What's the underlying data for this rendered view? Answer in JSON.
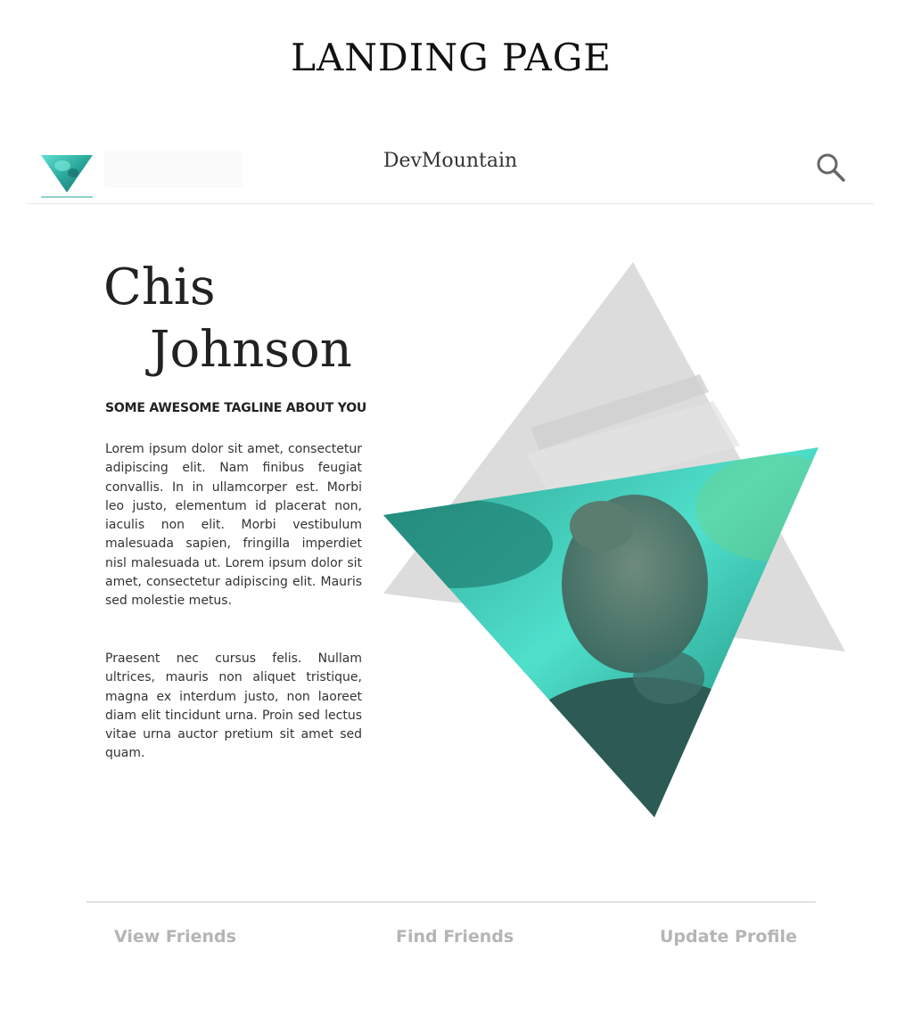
{
  "page": {
    "title": "LANDING PAGE"
  },
  "header": {
    "brand": "DevMountain",
    "search_input_value": "",
    "logo_icon": "triangle-logo-icon",
    "search_icon": "search-icon"
  },
  "hero": {
    "first_name": "Chis",
    "last_name": "Johnson",
    "tagline": "SOME AWESOME TAGLINE ABOUT YOU",
    "paragraphs": [
      "Lorem ipsum dolor sit amet, consectetur adipiscing elit. Nam finibus feugiat convallis. In in ullamcorper est. Morbi leo justo, elementum id placerat non, iaculis non elit. Morbi vestibulum malesuada sapien, fringilla imperdiet nisl malesuada ut. Lorem ipsum dolor sit amet, consectetur adipiscing elit. Mauris sed molestie metus.",
      "Praesent nec cursus felis. Nullam ultrices, mauris non aliquet tristique, magna ex interdum justo, non laoreet diam elit tincidunt urna. Proin sed lectus vitae urna auctor pretium sit amet sed quam."
    ]
  },
  "footer": {
    "links": [
      "View Friends",
      "Find Friends",
      "Update Profile"
    ]
  },
  "colors": {
    "accent": "#3fd6c4",
    "accent_dark": "#1f8f86",
    "gray_triangle": "#dadada",
    "footer_text": "#b5b5b5"
  }
}
